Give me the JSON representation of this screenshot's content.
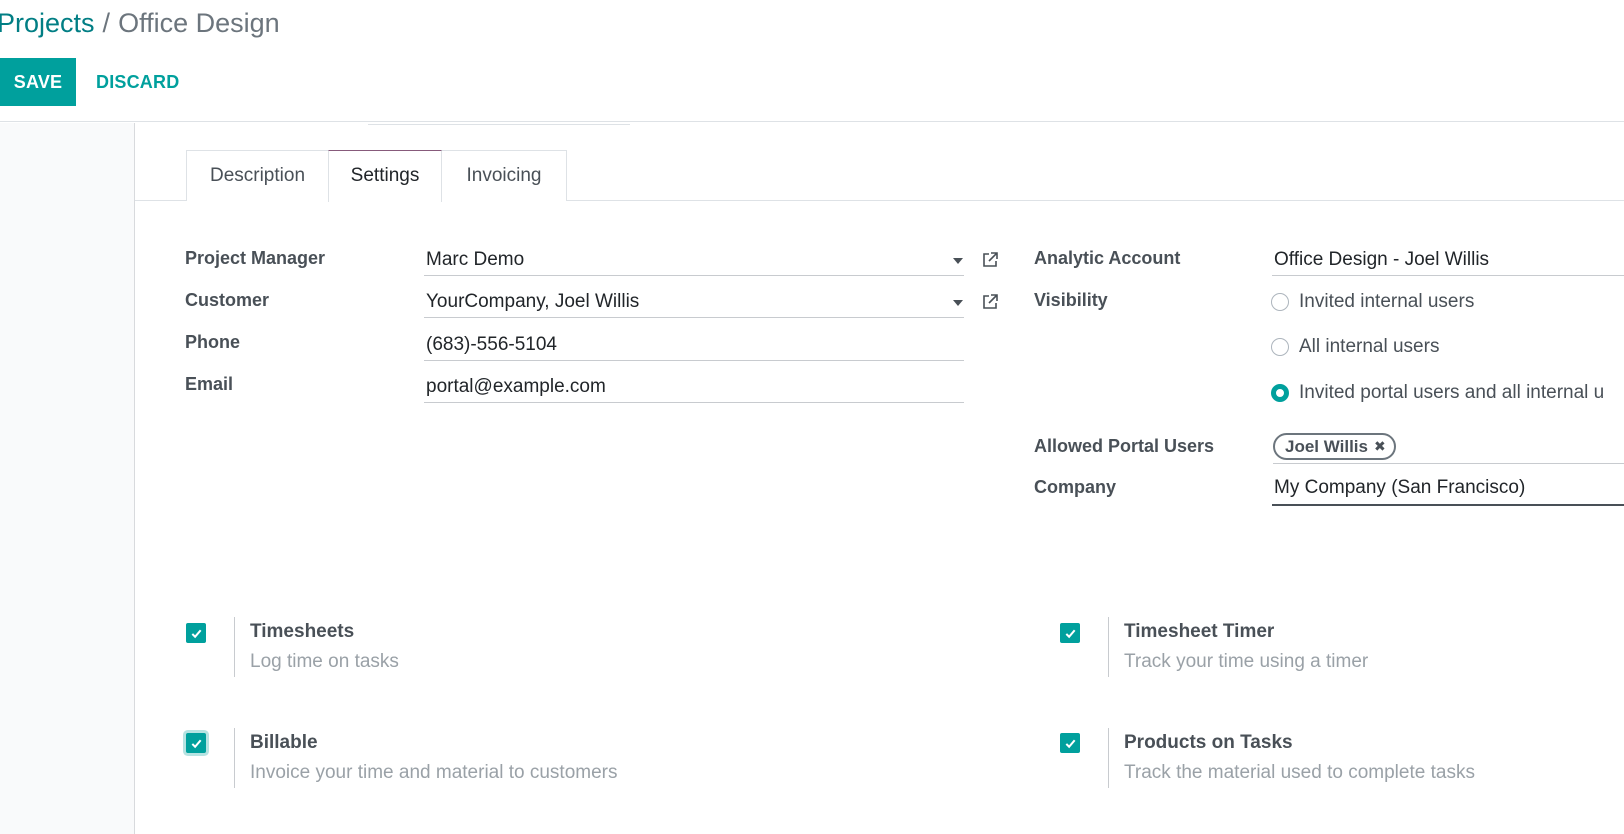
{
  "breadcrumb": {
    "parent": "Projects",
    "separator": "/",
    "current": "Office Design"
  },
  "toolbar": {
    "save_label": "SAVE",
    "discard_label": "DISCARD"
  },
  "tabs": [
    {
      "label": "Description",
      "active": false
    },
    {
      "label": "Settings",
      "active": true
    },
    {
      "label": "Invoicing",
      "active": false
    }
  ],
  "form": {
    "project_manager": {
      "label": "Project Manager",
      "value": "Marc Demo"
    },
    "customer": {
      "label": "Customer",
      "value": "YourCompany, Joel Willis"
    },
    "phone": {
      "label": "Phone",
      "value": "(683)-556-5104"
    },
    "email": {
      "label": "Email",
      "value": "portal@example.com"
    },
    "analytic_account": {
      "label": "Analytic Account",
      "value": "Office Design - Joel Willis"
    },
    "visibility": {
      "label": "Visibility",
      "options": [
        {
          "label": "Invited internal users",
          "checked": false
        },
        {
          "label": "All internal users",
          "checked": false
        },
        {
          "label": "Invited portal users and all internal u",
          "checked": true
        }
      ]
    },
    "allowed_portal_users": {
      "label": "Allowed Portal Users",
      "tags": [
        "Joel Willis"
      ],
      "remove_glyph": "✖"
    },
    "company": {
      "label": "Company",
      "value": "My Company (San Francisco)"
    }
  },
  "settings": [
    {
      "title": "Timesheets",
      "description": "Log time on tasks",
      "checked": true
    },
    {
      "title": "Timesheet Timer",
      "description": "Track your time using a timer",
      "checked": true
    },
    {
      "title": "Billable",
      "description": "Invoice your time and material to customers",
      "checked": true
    },
    {
      "title": "Products on Tasks",
      "description": "Track the material used to complete tasks",
      "checked": true
    }
  ],
  "colors": {
    "primary": "#00a09d",
    "link": "#017e84",
    "tab_accent": "#875a7b",
    "muted": "#9aa1a7"
  },
  "icons": {
    "external_link": "external-link-icon",
    "dropdown": "caret-down-icon",
    "check": "check-icon"
  }
}
